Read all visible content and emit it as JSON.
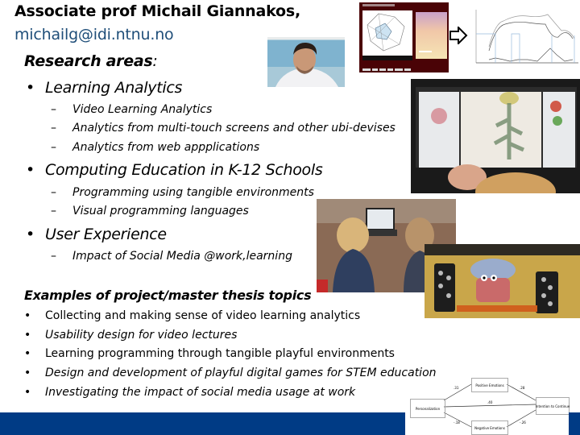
{
  "header": {
    "name_title": "Associate prof Michail Giannakos,",
    "email": "michailg@idi.ntnu.no"
  },
  "research": {
    "heading": "Research areas",
    "heading_colon": ":",
    "areas": [
      {
        "label": "Learning Analytics",
        "subitems": [
          "Video Learning Analytics",
          "Analytics from multi-touch screens and other ubi-devises",
          "Analytics from web appplications"
        ]
      },
      {
        "label": "Computing Education in K-12 Schools",
        "subitems": [
          "Programming using tangible environments",
          "Visual programming languages"
        ]
      },
      {
        "label": "User Experience",
        "subitems": [
          "Impact of Social Media @work,learning"
        ]
      }
    ]
  },
  "examples": {
    "heading": "Examples of project/master thesis topics",
    "topics": [
      "Collecting and making sense of video learning analytics",
      "Usability design for video lectures",
      "Learning programming through tangible playful environments",
      "Design and development of playful digital games for STEM education",
      "Investigating the impact of social media usage at work"
    ]
  },
  "symbols": {
    "bullet": "•",
    "dash": "–"
  },
  "diagram": {
    "nodes": {
      "left": "Personalization",
      "top": "Positive Emotions",
      "bottom": "Negative Emotions",
      "right": "Intention to Continue"
    },
    "edge_labels": {
      "left_top": ".31",
      "top_right": ".28",
      "left_right": ".40",
      "left_bottom": "-.18",
      "bottom_right": "-.26"
    }
  },
  "colors": {
    "footer": "#003b85",
    "email": "#1f4e79"
  }
}
